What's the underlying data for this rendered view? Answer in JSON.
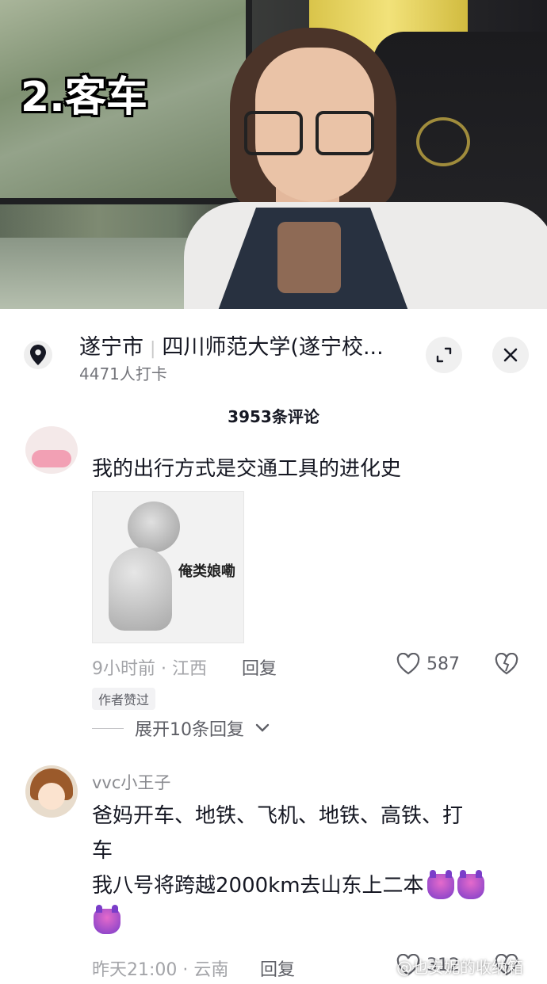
{
  "video": {
    "label": "2.客车"
  },
  "location": {
    "city": "遂宁市",
    "place": "四川师范大学(遂宁校...",
    "checkins": "4471人打卡"
  },
  "comments_header": {
    "count": "3953条评论"
  },
  "comment1": {
    "text": "我的出行方式是交通工具的进化史",
    "sticker_text": "俺类娘嘞",
    "time": "9小时前 · 江西",
    "reply": "回复",
    "likes": "587",
    "badge": "作者赞过",
    "expand": "展开10条回复"
  },
  "comment2": {
    "name": "vvc小王子",
    "line1": "爸妈开车、地铁、飞机、地铁、高铁、打",
    "line2": "车",
    "line3": "我八号将跨越2000km去山东上二本",
    "time": "昨天21:00 · 云南",
    "reply": "回复",
    "likes": "312"
  },
  "watermark": "@也安妮的收纳箱",
  "icons": [
    "location-pin-icon",
    "expand-icon",
    "close-icon",
    "heart-icon",
    "broken-heart-icon",
    "chevron-down-icon",
    "devil-emoji-icon"
  ]
}
